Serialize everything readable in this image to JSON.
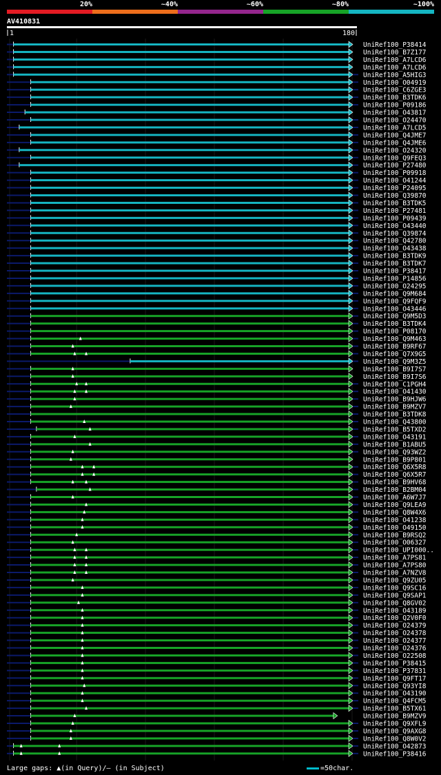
{
  "query_name": "AV410831",
  "color_scale": {
    "labels": [
      "20%",
      "~40%",
      "~60%",
      "~80%",
      "~100%"
    ],
    "colors": [
      "#e31b23",
      "#ee6e1c",
      "#94268d",
      "#17a327",
      "#15b5c2"
    ]
  },
  "footer": {
    "gaps_label": "Large gaps: ▲(in Query)/— (in Subject)",
    "scale_label": "=50char."
  },
  "chart_data": {
    "type": "alignment-overview",
    "query_ruler": {
      "start_label": "1",
      "end_label": "180",
      "length": 180
    },
    "legend": [
      {
        "class": "green",
        "color": "#17a327",
        "label": "~80%"
      },
      {
        "class": "cyan",
        "color": "#15b5c2",
        "label": "~100%"
      }
    ],
    "hits": [
      {
        "name": "UniRef100_P38414",
        "color": "cyan",
        "qstart": 3,
        "qend": 180,
        "overhang_right": false,
        "qgaps": []
      },
      {
        "name": "UniRef100_B7Z177",
        "color": "cyan",
        "qstart": 3,
        "qend": 180,
        "overhang_right": false,
        "qgaps": []
      },
      {
        "name": "UniRef100_A7LCD6",
        "color": "cyan",
        "qstart": 3,
        "qend": 180,
        "overhang_right": false,
        "qgaps": []
      },
      {
        "name": "UniRef100_A7LCD6",
        "color": "cyan",
        "qstart": 3,
        "qend": 180,
        "overhang_right": false,
        "qgaps": []
      },
      {
        "name": "UniRef100_A5HIG3",
        "color": "cyan",
        "qstart": 3,
        "qend": 180,
        "overhang_right": true,
        "qgaps": []
      },
      {
        "name": "UniRef100_O04919",
        "color": "cyan",
        "qstart": 12,
        "qend": 180,
        "overhang_right": true,
        "qgaps": []
      },
      {
        "name": "UniRef100_C6ZGE3",
        "color": "cyan",
        "qstart": 12,
        "qend": 180,
        "overhang_right": true,
        "qgaps": []
      },
      {
        "name": "UniRef100_B3TDK6",
        "color": "cyan",
        "qstart": 12,
        "qend": 180,
        "overhang_right": true,
        "qgaps": []
      },
      {
        "name": "UniRef100_P09186",
        "color": "cyan",
        "qstart": 12,
        "qend": 180,
        "overhang_right": true,
        "qgaps": []
      },
      {
        "name": "UniRef100_O43817",
        "color": "cyan",
        "qstart": 9,
        "qend": 180,
        "overhang_right": false,
        "qgaps": []
      },
      {
        "name": "UniRef100_O24470",
        "color": "cyan",
        "qstart": 12,
        "qend": 180,
        "overhang_right": true,
        "qgaps": []
      },
      {
        "name": "UniRef100_A7LCD5",
        "color": "cyan",
        "qstart": 6,
        "qend": 180,
        "overhang_right": true,
        "qgaps": []
      },
      {
        "name": "UniRef100_Q4JME7",
        "color": "cyan",
        "qstart": 12,
        "qend": 180,
        "overhang_right": true,
        "qgaps": []
      },
      {
        "name": "UniRef100_Q4JME6",
        "color": "cyan",
        "qstart": 12,
        "qend": 180,
        "overhang_right": true,
        "qgaps": []
      },
      {
        "name": "UniRef100_O24320",
        "color": "cyan",
        "qstart": 6,
        "qend": 180,
        "overhang_right": true,
        "qgaps": []
      },
      {
        "name": "UniRef100_Q9FEQ3",
        "color": "cyan",
        "qstart": 12,
        "qend": 180,
        "overhang_right": true,
        "qgaps": []
      },
      {
        "name": "UniRef100_P27480",
        "color": "cyan",
        "qstart": 6,
        "qend": 180,
        "overhang_right": true,
        "qgaps": []
      },
      {
        "name": "UniRef100_P09918",
        "color": "cyan",
        "qstart": 12,
        "qend": 180,
        "overhang_right": true,
        "qgaps": []
      },
      {
        "name": "UniRef100_O41244",
        "color": "cyan",
        "qstart": 12,
        "qend": 180,
        "overhang_right": true,
        "qgaps": []
      },
      {
        "name": "UniRef100_P24095",
        "color": "cyan",
        "qstart": 12,
        "qend": 180,
        "overhang_right": true,
        "qgaps": []
      },
      {
        "name": "UniRef100_Q39870",
        "color": "cyan",
        "qstart": 12,
        "qend": 180,
        "overhang_right": true,
        "qgaps": []
      },
      {
        "name": "UniRef100_B3TDK5",
        "color": "cyan",
        "qstart": 12,
        "qend": 180,
        "overhang_right": true,
        "qgaps": []
      },
      {
        "name": "UniRef100_P27481",
        "color": "cyan",
        "qstart": 12,
        "qend": 180,
        "overhang_right": true,
        "qgaps": []
      },
      {
        "name": "UniRef100_P09439",
        "color": "cyan",
        "qstart": 12,
        "qend": 180,
        "overhang_right": true,
        "qgaps": []
      },
      {
        "name": "UniRef100_O43440",
        "color": "cyan",
        "qstart": 12,
        "qend": 180,
        "overhang_right": true,
        "qgaps": []
      },
      {
        "name": "UniRef100_Q39874",
        "color": "cyan",
        "qstart": 12,
        "qend": 180,
        "overhang_right": true,
        "qgaps": []
      },
      {
        "name": "UniRef100_Q42780",
        "color": "cyan",
        "qstart": 12,
        "qend": 180,
        "overhang_right": true,
        "qgaps": []
      },
      {
        "name": "UniRef100_O43438",
        "color": "cyan",
        "qstart": 12,
        "qend": 180,
        "overhang_right": true,
        "qgaps": []
      },
      {
        "name": "UniRef100_B3TDK9",
        "color": "cyan",
        "qstart": 12,
        "qend": 180,
        "overhang_right": true,
        "qgaps": []
      },
      {
        "name": "UniRef100_B3TDK7",
        "color": "cyan",
        "qstart": 12,
        "qend": 180,
        "overhang_right": true,
        "qgaps": []
      },
      {
        "name": "UniRef100_P38417",
        "color": "cyan",
        "qstart": 12,
        "qend": 180,
        "overhang_right": true,
        "qgaps": []
      },
      {
        "name": "UniRef100_P14856",
        "color": "cyan",
        "qstart": 12,
        "qend": 180,
        "overhang_right": true,
        "qgaps": []
      },
      {
        "name": "UniRef100_O24295",
        "color": "cyan",
        "qstart": 12,
        "qend": 180,
        "overhang_right": true,
        "qgaps": []
      },
      {
        "name": "UniRef100_Q9M684",
        "color": "cyan",
        "qstart": 12,
        "qend": 180,
        "overhang_right": true,
        "qgaps": []
      },
      {
        "name": "UniRef100_Q9FQF9",
        "color": "cyan",
        "qstart": 12,
        "qend": 180,
        "overhang_right": true,
        "qgaps": []
      },
      {
        "name": "UniRef100_O43446",
        "color": "cyan",
        "qstart": 12,
        "qend": 180,
        "overhang_right": true,
        "qgaps": []
      },
      {
        "name": "UniRef100_Q9M5D3",
        "color": "green",
        "qstart": 12,
        "qend": 180,
        "overhang_right": true,
        "qgaps": []
      },
      {
        "name": "UniRef100_B3TDK4",
        "color": "green",
        "qstart": 12,
        "qend": 180,
        "overhang_right": true,
        "qgaps": []
      },
      {
        "name": "UniRef100_P08170",
        "color": "green",
        "qstart": 12,
        "qend": 180,
        "overhang_right": true,
        "qgaps": []
      },
      {
        "name": "UniRef100_Q9M463",
        "color": "green",
        "qstart": 12,
        "qend": 180,
        "overhang_right": true,
        "qgaps": [
          38
        ]
      },
      {
        "name": "UniRef100_B9RF67",
        "color": "green",
        "qstart": 12,
        "qend": 180,
        "overhang_right": true,
        "qgaps": [
          34
        ]
      },
      {
        "name": "UniRef100_Q7X9G5",
        "color": "green",
        "qstart": 12,
        "qend": 180,
        "overhang_right": true,
        "qgaps": [
          35,
          41
        ]
      },
      {
        "name": "UniRef100_Q9M3Z5",
        "color": "cyan",
        "qstart": 64,
        "qend": 180,
        "overhang_right": true,
        "qgaps": []
      },
      {
        "name": "UniRef100_B9I7S7",
        "color": "green",
        "qstart": 12,
        "qend": 180,
        "overhang_right": false,
        "qgaps": [
          34
        ]
      },
      {
        "name": "UniRef100_B9I7S6",
        "color": "green",
        "qstart": 12,
        "qend": 180,
        "overhang_right": false,
        "qgaps": [
          34
        ]
      },
      {
        "name": "UniRef100_C1PGH4",
        "color": "green",
        "qstart": 12,
        "qend": 180,
        "overhang_right": true,
        "qgaps": [
          36,
          41
        ]
      },
      {
        "name": "UniRef100_O41430",
        "color": "green",
        "qstart": 12,
        "qend": 180,
        "overhang_right": true,
        "qgaps": [
          35,
          41
        ]
      },
      {
        "name": "UniRef100_B9HJW6",
        "color": "green",
        "qstart": 12,
        "qend": 180,
        "overhang_right": true,
        "qgaps": [
          35
        ]
      },
      {
        "name": "UniRef100_B9MZV7",
        "color": "green",
        "qstart": 12,
        "qend": 180,
        "overhang_right": true,
        "qgaps": [
          33
        ]
      },
      {
        "name": "UniRef100_B3TDK8",
        "color": "green",
        "qstart": 12,
        "qend": 180,
        "overhang_right": true,
        "qgaps": []
      },
      {
        "name": "UniRef100_Q43800",
        "color": "green",
        "qstart": 12,
        "qend": 180,
        "overhang_right": true,
        "qgaps": [
          40
        ]
      },
      {
        "name": "UniRef100_B5TXD2",
        "color": "green",
        "qstart": 15,
        "qend": 180,
        "overhang_right": true,
        "qgaps": [
          43
        ]
      },
      {
        "name": "UniRef100_O43191",
        "color": "green",
        "qstart": 12,
        "qend": 180,
        "overhang_right": true,
        "qgaps": [
          35
        ]
      },
      {
        "name": "UniRef100_B1ABU5",
        "color": "green",
        "qstart": 12,
        "qend": 180,
        "overhang_right": true,
        "qgaps": [
          43
        ]
      },
      {
        "name": "UniRef100_Q93WZ2",
        "color": "green",
        "qstart": 12,
        "qend": 180,
        "overhang_right": true,
        "qgaps": [
          34
        ]
      },
      {
        "name": "UniRef100_B9P801",
        "color": "green",
        "qstart": 12,
        "qend": 180,
        "overhang_right": false,
        "qgaps": [
          33
        ]
      },
      {
        "name": "UniRef100_Q6X5R8",
        "color": "green",
        "qstart": 12,
        "qend": 180,
        "overhang_right": true,
        "qgaps": [
          39,
          45
        ]
      },
      {
        "name": "UniRef100_Q6X5R7",
        "color": "green",
        "qstart": 12,
        "qend": 180,
        "overhang_right": true,
        "qgaps": [
          39,
          45
        ]
      },
      {
        "name": "UniRef100_B9HV68",
        "color": "green",
        "qstart": 12,
        "qend": 180,
        "overhang_right": true,
        "qgaps": [
          34,
          41
        ]
      },
      {
        "name": "UniRef100_B2BM04",
        "color": "green",
        "qstart": 15,
        "qend": 180,
        "overhang_right": true,
        "qgaps": [
          43
        ]
      },
      {
        "name": "UniRef100_A6W7J7",
        "color": "green",
        "qstart": 12,
        "qend": 180,
        "overhang_right": true,
        "qgaps": [
          34
        ]
      },
      {
        "name": "UniRef100_Q9LEA9",
        "color": "green",
        "qstart": 12,
        "qend": 180,
        "overhang_right": true,
        "qgaps": [
          41
        ]
      },
      {
        "name": "UniRef100_Q8W4X6",
        "color": "green",
        "qstart": 12,
        "qend": 180,
        "overhang_right": true,
        "qgaps": [
          40
        ]
      },
      {
        "name": "UniRef100_O41238",
        "color": "green",
        "qstart": 12,
        "qend": 180,
        "overhang_right": true,
        "qgaps": [
          39
        ]
      },
      {
        "name": "UniRef100_O49150",
        "color": "green",
        "qstart": 12,
        "qend": 180,
        "overhang_right": true,
        "qgaps": [
          39
        ]
      },
      {
        "name": "UniRef100_B9RSQ2",
        "color": "green",
        "qstart": 12,
        "qend": 180,
        "overhang_right": true,
        "qgaps": [
          36
        ]
      },
      {
        "name": "UniRef100_O06327",
        "color": "green",
        "qstart": 12,
        "qend": 180,
        "overhang_right": true,
        "qgaps": [
          34
        ]
      },
      {
        "name": "UniRef100_UPI000..",
        "color": "green",
        "qstart": 12,
        "qend": 180,
        "overhang_right": true,
        "qgaps": [
          35,
          41
        ]
      },
      {
        "name": "UniRef100_A7PS81",
        "color": "green",
        "qstart": 12,
        "qend": 180,
        "overhang_right": true,
        "qgaps": [
          35,
          41
        ]
      },
      {
        "name": "UniRef100_A7PS80",
        "color": "green",
        "qstart": 12,
        "qend": 180,
        "overhang_right": true,
        "qgaps": [
          35,
          41
        ]
      },
      {
        "name": "UniRef100_A7NZV8",
        "color": "green",
        "qstart": 12,
        "qend": 180,
        "overhang_right": true,
        "qgaps": [
          35,
          41
        ]
      },
      {
        "name": "UniRef100_Q9ZU05",
        "color": "green",
        "qstart": 12,
        "qend": 180,
        "overhang_right": true,
        "qgaps": [
          34
        ]
      },
      {
        "name": "UniRef100_Q9SC16",
        "color": "green",
        "qstart": 12,
        "qend": 180,
        "overhang_right": true,
        "qgaps": [
          39
        ]
      },
      {
        "name": "UniRef100_Q9SAP1",
        "color": "green",
        "qstart": 12,
        "qend": 180,
        "overhang_right": true,
        "qgaps": [
          39
        ]
      },
      {
        "name": "UniRef100_Q8GV02",
        "color": "green",
        "qstart": 12,
        "qend": 180,
        "overhang_right": true,
        "qgaps": [
          37
        ]
      },
      {
        "name": "UniRef100_O43189",
        "color": "green",
        "qstart": 12,
        "qend": 180,
        "overhang_right": true,
        "qgaps": [
          39
        ]
      },
      {
        "name": "UniRef100_Q2V0F0",
        "color": "green",
        "qstart": 12,
        "qend": 180,
        "overhang_right": true,
        "qgaps": [
          39
        ]
      },
      {
        "name": "UniRef100_O24379",
        "color": "green",
        "qstart": 12,
        "qend": 180,
        "overhang_right": true,
        "qgaps": [
          39
        ]
      },
      {
        "name": "UniRef100_O24378",
        "color": "green",
        "qstart": 12,
        "qend": 180,
        "overhang_right": true,
        "qgaps": [
          39
        ]
      },
      {
        "name": "UniRef100_O24377",
        "color": "green",
        "qstart": 12,
        "qend": 180,
        "overhang_right": true,
        "qgaps": [
          39
        ]
      },
      {
        "name": "UniRef100_O24376",
        "color": "green",
        "qstart": 12,
        "qend": 180,
        "overhang_right": true,
        "qgaps": [
          39
        ]
      },
      {
        "name": "UniRef100_O22508",
        "color": "green",
        "qstart": 12,
        "qend": 180,
        "overhang_right": true,
        "qgaps": [
          39
        ]
      },
      {
        "name": "UniRef100_P38415",
        "color": "green",
        "qstart": 12,
        "qend": 180,
        "overhang_right": true,
        "qgaps": [
          39
        ]
      },
      {
        "name": "UniRef100_P37831",
        "color": "green",
        "qstart": 12,
        "qend": 180,
        "overhang_right": true,
        "qgaps": [
          39
        ]
      },
      {
        "name": "UniRef100_Q9FT17",
        "color": "green",
        "qstart": 12,
        "qend": 180,
        "overhang_right": true,
        "qgaps": [
          39
        ]
      },
      {
        "name": "UniRef100_Q93YI8",
        "color": "green",
        "qstart": 12,
        "qend": 180,
        "overhang_right": true,
        "qgaps": [
          40
        ]
      },
      {
        "name": "UniRef100_O43190",
        "color": "green",
        "qstart": 12,
        "qend": 180,
        "overhang_right": true,
        "qgaps": [
          39
        ]
      },
      {
        "name": "UniRef100_Q4FCM5",
        "color": "green",
        "qstart": 12,
        "qend": 180,
        "overhang_right": true,
        "qgaps": [
          39
        ]
      },
      {
        "name": "UniRef100_B5TX61",
        "color": "green",
        "qstart": 12,
        "qend": 180,
        "overhang_right": true,
        "qgaps": [
          41
        ]
      },
      {
        "name": "UniRef100_B9MZV9",
        "color": "green",
        "qstart": 12,
        "qend": 172,
        "overhang_right": false,
        "qgaps": [
          35
        ]
      },
      {
        "name": "UniRef100_Q9XFL9",
        "color": "green",
        "qstart": 12,
        "qend": 180,
        "overhang_right": true,
        "qgaps": [
          34
        ]
      },
      {
        "name": "UniRef100_Q9AXG8",
        "color": "green",
        "qstart": 12,
        "qend": 180,
        "overhang_right": true,
        "qgaps": [
          33
        ]
      },
      {
        "name": "UniRef100_Q8W0V2",
        "color": "green",
        "qstart": 12,
        "qend": 180,
        "overhang_right": true,
        "qgaps": [
          33
        ]
      },
      {
        "name": "UniRef100_O42873",
        "color": "green",
        "qstart": 3,
        "qend": 180,
        "overhang_right": true,
        "qgaps": [
          7,
          27
        ]
      },
      {
        "name": "UniRef100_P38416",
        "color": "green",
        "qstart": 3,
        "qend": 180,
        "overhang_right": true,
        "qgaps": [
          7,
          27
        ]
      }
    ]
  }
}
